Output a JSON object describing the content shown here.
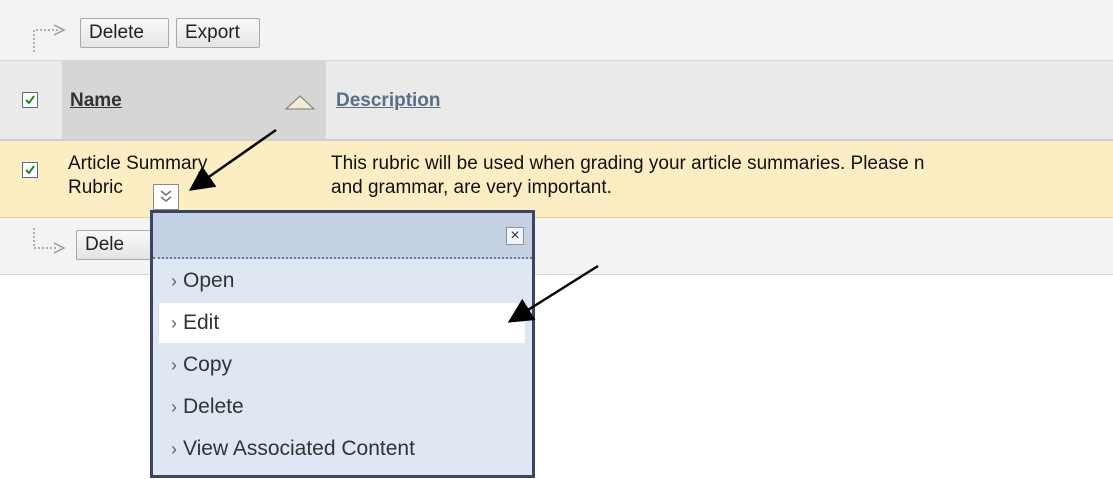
{
  "toolbar_top": {
    "delete_label": "Delete",
    "export_label": "Export"
  },
  "table": {
    "headers": {
      "name": "Name",
      "description": "Description"
    },
    "rows": [
      {
        "name_line1": "Article Summary",
        "name_line2": "Rubric",
        "description_line1": "This rubric will be used when grading your article summaries. Please n",
        "description_line2": "and grammar, are very important.",
        "checked": true
      }
    ]
  },
  "toolbar_bottom": {
    "delete_label": "Dele"
  },
  "context_menu": {
    "close_glyph": "×",
    "items": [
      {
        "label": "Open"
      },
      {
        "label": "Edit",
        "active": true
      },
      {
        "label": "Copy"
      },
      {
        "label": "Delete"
      },
      {
        "label": "View Associated Content"
      }
    ]
  },
  "icons": {
    "toolbar_arrow": "corner-arrow-icon",
    "sort": "sort-ascending-icon",
    "dropdown": "double-chevron-down-icon",
    "annotation": "annotation-arrow-icon"
  },
  "colors": {
    "row_highlight": "#fdedc2",
    "menu_border": "#3b4465",
    "menu_bg": "#dfe7f3",
    "link": "#5a6e86"
  }
}
